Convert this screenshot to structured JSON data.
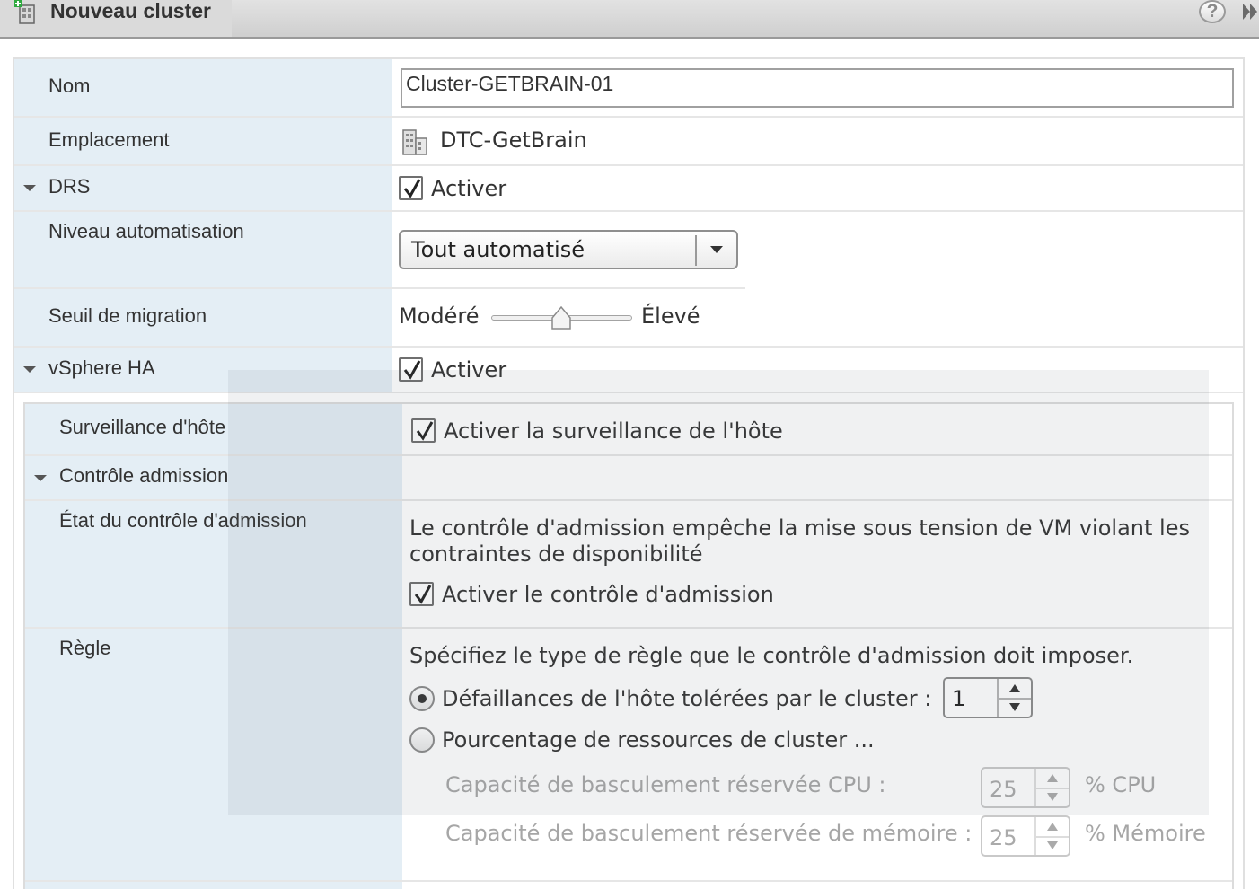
{
  "window": {
    "title": "Nouveau cluster",
    "help_label": "?"
  },
  "form": {
    "name": {
      "label": "Nom",
      "value": "Cluster-GETBRAIN-01"
    },
    "location": {
      "label": "Emplacement",
      "value": "DTC-GetBrain"
    },
    "drs": {
      "label": "DRS",
      "enable_label": "Activer",
      "enabled": true,
      "automation_label": "Niveau automatisation",
      "automation_value": "Tout automatisé",
      "migration_label": "Seuil de migration",
      "slider_min_label": "Modéré",
      "slider_max_label": "Élevé",
      "slider_value": 0.5
    },
    "ha": {
      "label": "vSphere HA",
      "enable_label": "Activer",
      "enabled": true,
      "host_monitoring_label": "Surveillance d'hôte",
      "host_monitoring_checkbox": "Activer la surveillance de l'hôte",
      "host_monitoring_enabled": true,
      "admission_section_label": "Contrôle admission",
      "admission_state_label": "État du contrôle d'admission",
      "admission_description_line1": "Le contrôle d'admission empêche la mise sous tension de VM violant les",
      "admission_description_line2": "contraintes de disponibilité",
      "admission_checkbox": "Activer le contrôle d'admission",
      "admission_enabled": true,
      "rule_label": "Règle",
      "rule_description": "Spécifiez le type de règle que le contrôle d'admission doit imposer.",
      "rule_option_failures": "Défaillances de l'hôte tolérées par le cluster :",
      "rule_failures_value": "1",
      "rule_option_percentage": "Pourcentage de ressources de cluster ...",
      "cpu_capacity_label": "Capacité de basculement réservée CPU :",
      "cpu_capacity_value": "25",
      "cpu_unit": "% CPU",
      "mem_capacity_label": "Capacité de basculement réservée de mémoire :",
      "mem_capacity_value": "25",
      "mem_unit": "% Mémoire"
    }
  }
}
